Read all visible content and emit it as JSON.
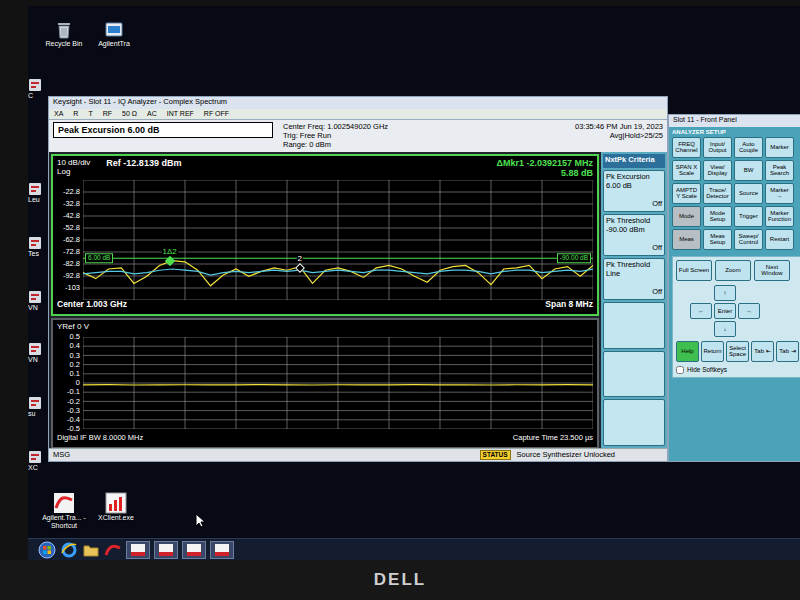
{
  "desktop": {
    "icons": [
      {
        "label": "Recycle Bin",
        "kind": "trash"
      },
      {
        "label": "AgilentTra",
        "kind": "app"
      }
    ],
    "side_icons": [
      {
        "label": "C"
      },
      {
        "label": "Leu"
      },
      {
        "label": "Tes"
      },
      {
        "label": "VN"
      },
      {
        "label": "VN"
      },
      {
        "label": "su"
      },
      {
        "label": "XC"
      }
    ],
    "bottom_icons": [
      {
        "label": "Agilent.Tra... - Shortcut",
        "kind": "agilent"
      },
      {
        "label": "XClient.exe",
        "kind": "xclient"
      }
    ]
  },
  "analyzer": {
    "title": "Keysight - Slot 11 - IQ Analyzer - Complex Spectrum",
    "annunciators": [
      "XA",
      "R",
      "T",
      "RF",
      "50 Ω",
      "AC",
      "INT REF",
      "RF OFF"
    ],
    "active_function": "Peak Excursion 6.00 dB",
    "settings": [
      "Center Freq: 1.002549020 GHz",
      "Trig: Free Run",
      "Range: 0 dBm"
    ],
    "avg_hold": "Avg|Hold>25/25",
    "timestamp": "03:35:46 PM Jun 19, 2023",
    "spectrum": {
      "scale": "10 dB/div",
      "scale_type": "Log",
      "ref": "Ref -12.8139 dBm",
      "marker_readout": "ΔMkr1 -2.0392157 MHz",
      "marker_value": "5.88 dB",
      "y_ticks": [
        "-22.8",
        "-32.8",
        "-42.8",
        "-52.8",
        "-62.8",
        "-72.8",
        "-82.8",
        "-92.8",
        "-103"
      ],
      "range": {
        "top": -12.8139,
        "bottom": -112.8139,
        "x_min": -4,
        "x_max": 4
      },
      "series": [
        {
          "name": "trace-1",
          "color": "#f2e23a",
          "values": [
            -90,
            -95,
            -87,
            -86,
            -99,
            -93,
            -84,
            -80,
            -81,
            -88,
            -101,
            -92,
            -87,
            -93,
            -89,
            -86,
            -88,
            -85,
            -99,
            -88,
            -86,
            -89,
            -94,
            -86,
            -84,
            -87,
            -93,
            -98,
            -88,
            -85,
            -84,
            -90,
            -100,
            -87,
            -86,
            -84,
            -95,
            -87,
            -85,
            -93,
            -84
          ]
        },
        {
          "name": "trace-2",
          "color": "#55c8e6",
          "values": [
            -91,
            -90,
            -89,
            -89,
            -91,
            -90,
            -88,
            -87,
            -88,
            -89,
            -92,
            -90,
            -89,
            -90,
            -89,
            -88,
            -89,
            -88,
            -90,
            -89,
            -88,
            -89,
            -90,
            -88,
            -88,
            -89,
            -90,
            -91,
            -89,
            -88,
            -88,
            -89,
            -91,
            -89,
            -88,
            -88,
            -90,
            -89,
            -88,
            -89,
            -87
          ]
        }
      ],
      "threshold": {
        "value": -78,
        "label_left": "6.00 dB",
        "label_right": "-90.00 dB"
      },
      "markers": [
        {
          "label": "1Δ2",
          "x": -2.64,
          "y": -80,
          "selected": true
        },
        {
          "label": "2",
          "x": -0.6,
          "y": -85.9,
          "selected": false
        }
      ],
      "center": "Center 1.003 GHz",
      "span": "Span 8 MHz"
    },
    "waveform": {
      "ref": "YRef 0 V",
      "y_ticks": [
        "0.5",
        "0.4",
        "0.3",
        "0.2",
        "0.1",
        "0",
        "-0.1",
        "-0.2",
        "-0.3",
        "-0.4",
        "-0.5"
      ],
      "range": {
        "top": 0.5,
        "bottom": -0.5
      },
      "series": [
        {
          "name": "waveform",
          "color": "#f2e23a",
          "values": [
            -0.02,
            -0.018,
            -0.022,
            -0.02,
            -0.019,
            -0.021,
            -0.02,
            -0.017,
            -0.02,
            -0.022,
            -0.019,
            -0.02,
            -0.021,
            -0.018,
            -0.02,
            -0.02,
            -0.022,
            -0.019,
            -0.02,
            -0.018,
            -0.021
          ]
        }
      ],
      "capture_time": "Capture Time 23.500 µs",
      "if_bw": "Digital IF BW 8.0000 MHz"
    },
    "status": {
      "msg": "MSG",
      "badge": "STATUS",
      "message": "Source Synthesizer Unlocked"
    },
    "softkeys": {
      "title": "NxtPk Criteria",
      "keys": [
        {
          "label": "Pk Excursion",
          "value": "6.00 dB",
          "state": "Off"
        },
        {
          "label": "Pk Threshold",
          "value": "-90.00 dBm",
          "state": "Off"
        },
        {
          "label": "Pk Threshold Line",
          "value": "",
          "state": "Off"
        }
      ]
    }
  },
  "front_panel": {
    "title": "Slot 11 - Front Panel",
    "group": "ANALYZER SETUP",
    "keys": [
      {
        "label": "FREQ Channel",
        "kind": "blue"
      },
      {
        "label": "Input/ Output",
        "kind": "blue"
      },
      {
        "label": "Auto Couple",
        "kind": "blue"
      },
      {
        "label": "Marker",
        "kind": "blue"
      },
      {
        "label": "SPAN X Scale",
        "kind": "blue"
      },
      {
        "label": "View/ Display",
        "kind": "blue"
      },
      {
        "label": "BW",
        "kind": "blue"
      },
      {
        "label": "Peak Search",
        "kind": "blue"
      },
      {
        "label": "AMPTD Y Scale",
        "kind": "blue"
      },
      {
        "label": "Trace/ Detector",
        "kind": "blue"
      },
      {
        "label": "Source",
        "kind": "blue"
      },
      {
        "label": "Marker →",
        "kind": "blue"
      },
      {
        "label": "Mode",
        "kind": "gray"
      },
      {
        "label": "Mode Setup",
        "kind": "blue"
      },
      {
        "label": "Trigger",
        "kind": "blue"
      },
      {
        "label": "Marker Function",
        "kind": "blue"
      },
      {
        "label": "Meas",
        "kind": "gray"
      },
      {
        "label": "Meas Setup",
        "kind": "blue"
      },
      {
        "label": "Sweep/ Control",
        "kind": "blue"
      },
      {
        "label": "Restart",
        "kind": "blue"
      }
    ],
    "nav_keys": [
      {
        "label": "Full Screen"
      },
      {
        "label": "Zoom"
      },
      {
        "label": "Next Window"
      }
    ],
    "arrows": [
      {
        "label": "↑"
      },
      {
        "label": "←"
      },
      {
        "label": "Enter"
      },
      {
        "label": "→"
      },
      {
        "label": "↓"
      }
    ],
    "bottom_keys": [
      {
        "label": "Help",
        "kind": "green"
      },
      {
        "label": "Return",
        "kind": "blue"
      },
      {
        "label": "Select Space",
        "kind": "blue"
      },
      {
        "label": "Tab ⇤",
        "kind": "blue"
      },
      {
        "label": "Tab ⇥",
        "kind": "blue"
      }
    ],
    "hide_softkeys": {
      "label": "Hide Softkeys",
      "checked": false
    }
  },
  "monitor": {
    "brand": "DELL"
  }
}
